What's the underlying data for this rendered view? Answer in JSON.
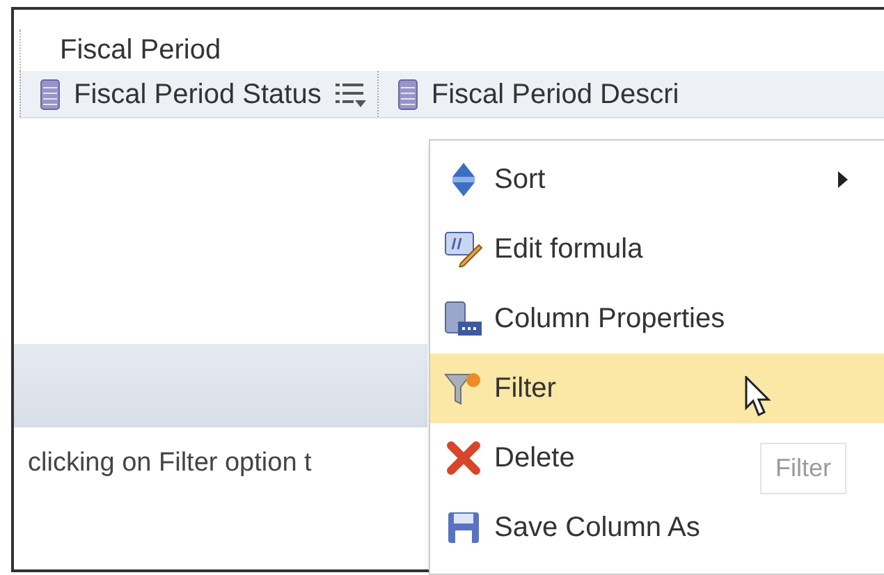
{
  "section": {
    "title": "Fiscal Period"
  },
  "columns": [
    {
      "label": "Fiscal Period Status",
      "has_menu": true
    },
    {
      "label": "Fiscal Period Descri",
      "has_menu": false
    }
  ],
  "caption": "clicking on Filter option t",
  "context_menu": {
    "items": [
      {
        "kind": "sort",
        "label": "Sort",
        "submenu": true,
        "selected": false
      },
      {
        "kind": "formula",
        "label": "Edit formula",
        "submenu": false,
        "selected": false
      },
      {
        "kind": "properties",
        "label": "Column Properties",
        "submenu": false,
        "selected": false
      },
      {
        "kind": "filter",
        "label": "Filter",
        "submenu": false,
        "selected": true
      },
      {
        "kind": "delete",
        "label": "Delete",
        "submenu": false,
        "selected": false
      },
      {
        "kind": "save",
        "label": "Save Column As",
        "submenu": false,
        "selected": false
      }
    ]
  },
  "tooltip": "Filter"
}
